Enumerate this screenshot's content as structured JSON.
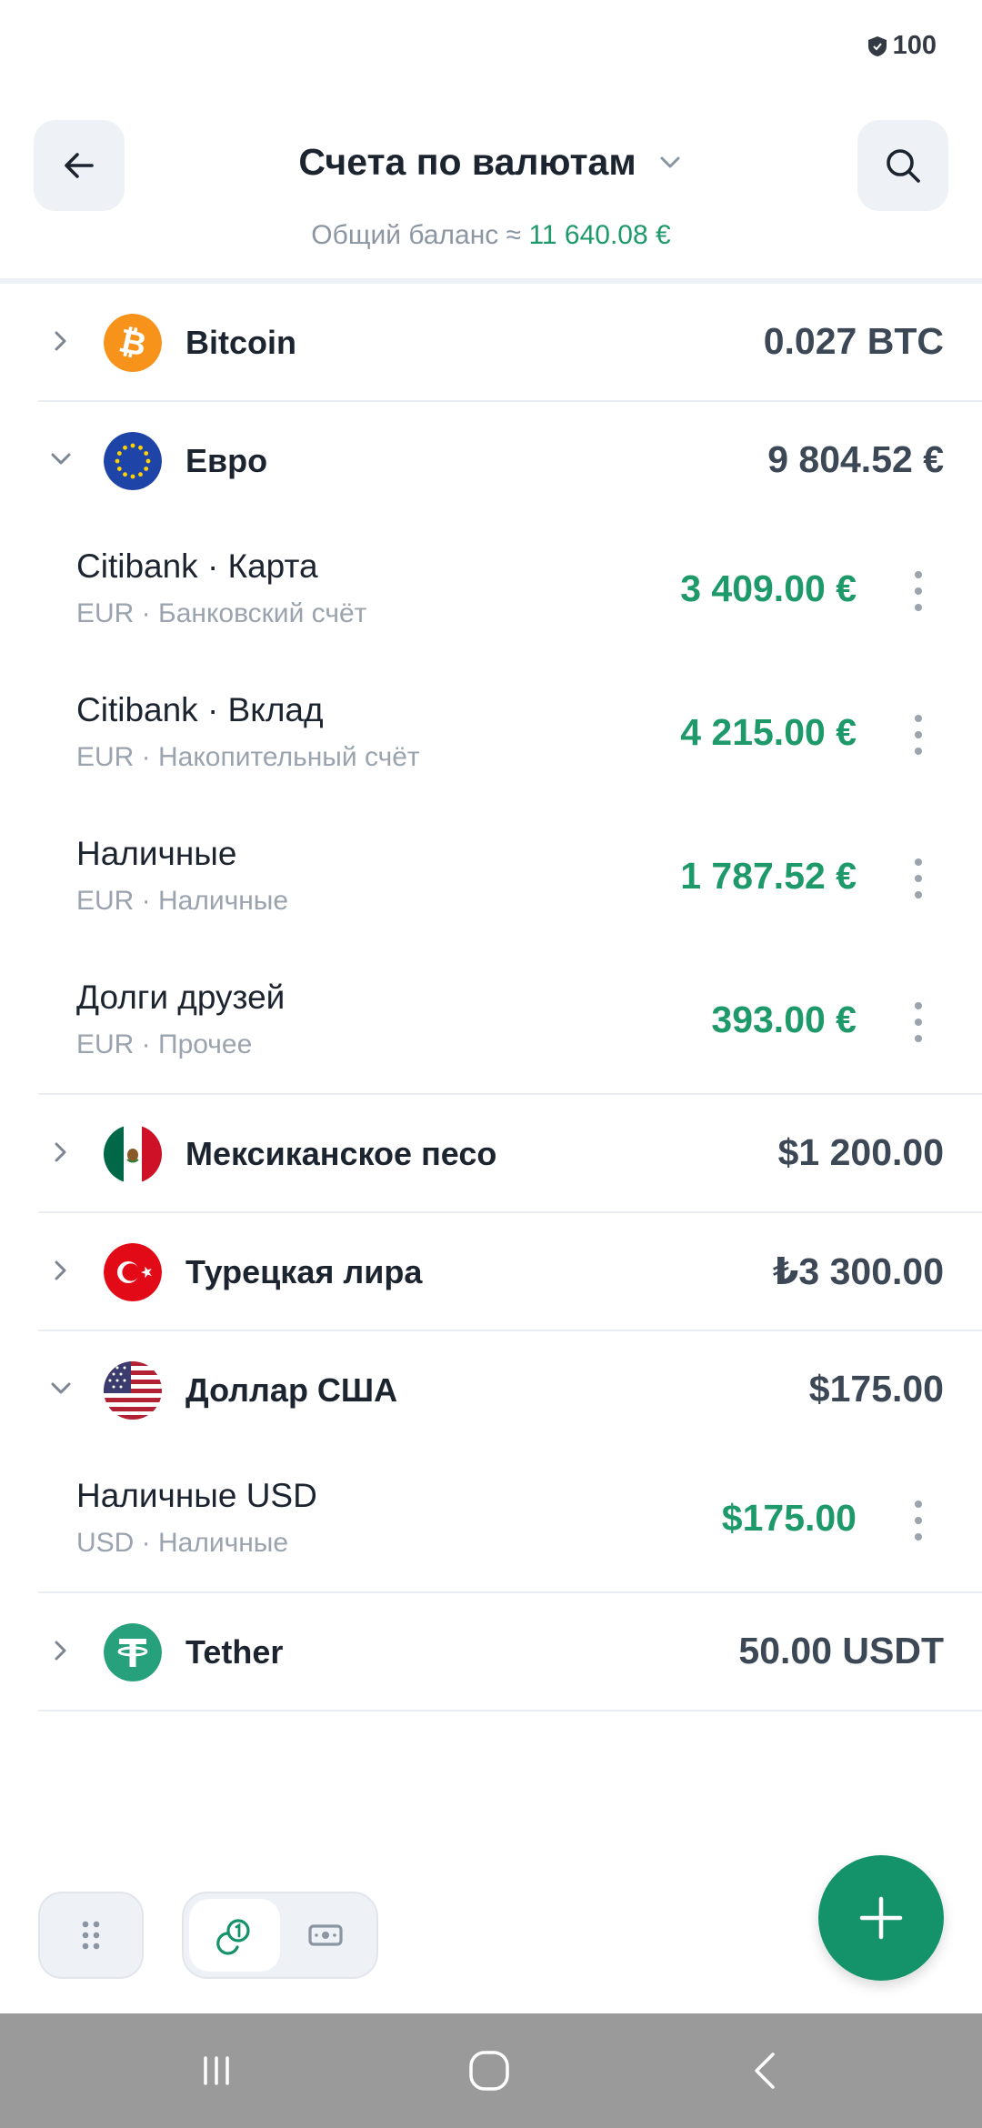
{
  "status_bar": {
    "battery": "100"
  },
  "header": {
    "title": "Счета по валютам",
    "subtitle_label": "Общий баланс ≈",
    "subtitle_amount": "11 640.08 €"
  },
  "groups": [
    {
      "name": "Bitcoin",
      "total": "0.027 BTC",
      "expanded": false,
      "icon": "bitcoin-icon"
    },
    {
      "name": "Евро",
      "total": "9 804.52 €",
      "expanded": true,
      "icon": "eu-flag-icon",
      "accounts": [
        {
          "name": "Citibank · Карта",
          "sub": "EUR · Банковский счёт",
          "balance": "3 409.00 €"
        },
        {
          "name": "Citibank · Вклад",
          "sub": "EUR · Накопительный счёт",
          "balance": "4 215.00 €"
        },
        {
          "name": "Наличные",
          "sub": "EUR · Наличные",
          "balance": "1 787.52 €"
        },
        {
          "name": "Долги друзей",
          "sub": "EUR · Прочее",
          "balance": "393.00 €"
        }
      ]
    },
    {
      "name": "Мексиканское песо",
      "total": "$1 200.00",
      "expanded": false,
      "icon": "mexico-flag-icon"
    },
    {
      "name": "Турецкая лира",
      "total": "₺3 300.00",
      "expanded": false,
      "icon": "turkey-flag-icon"
    },
    {
      "name": "Доллар США",
      "total": "$175.00",
      "expanded": true,
      "icon": "usa-flag-icon",
      "accounts": [
        {
          "name": "Наличные USD",
          "sub": "USD · Наличные",
          "balance": "$175.00"
        }
      ]
    },
    {
      "name": "Tether",
      "total": "50.00 USDT",
      "expanded": false,
      "icon": "tether-icon"
    }
  ],
  "colors": {
    "accent": "#1e9a6a",
    "fab": "#14936a",
    "text_primary": "#1c2430",
    "text_secondary": "#9aa3ae",
    "nav_bar": "#9a9a9a"
  }
}
